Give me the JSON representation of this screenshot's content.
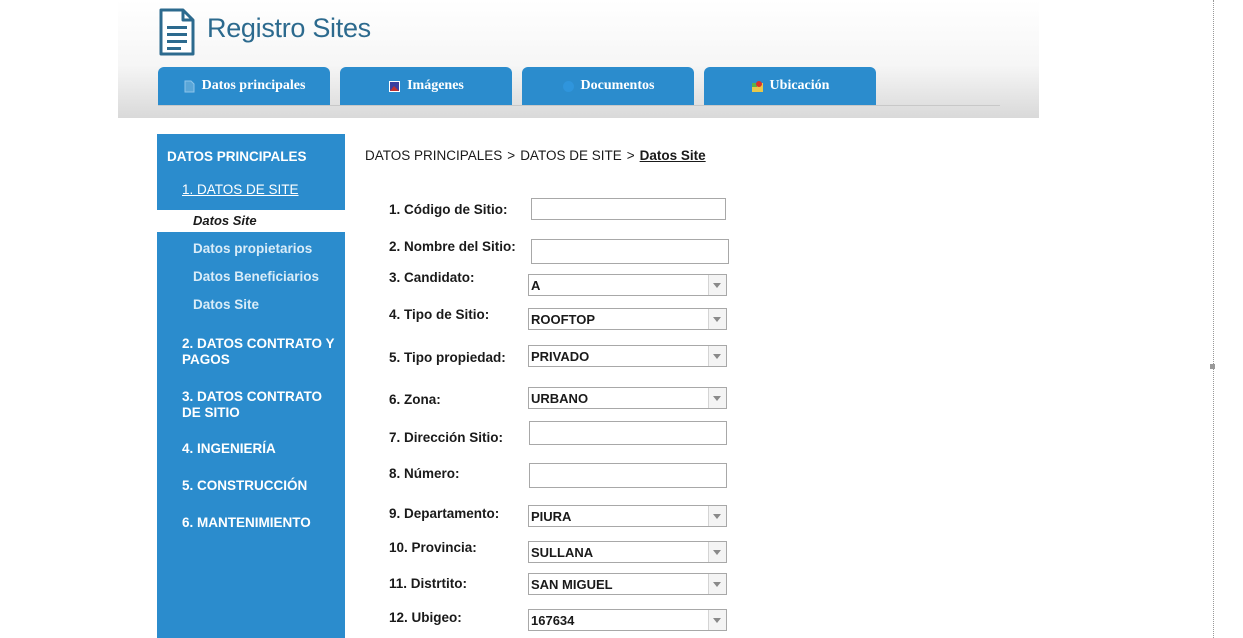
{
  "app": {
    "title": "Registro Sites"
  },
  "tabs": [
    {
      "label": "Datos principales",
      "icon": "document-icon"
    },
    {
      "label": "Imágenes",
      "icon": "image-icon"
    },
    {
      "label": "Documentos",
      "icon": "folder-icon"
    },
    {
      "label": "Ubicación",
      "icon": "map-icon"
    }
  ],
  "sidebar": {
    "heading": "DATOS PRINCIPALES",
    "section1": "1. DATOS DE SITE",
    "active_item": "Datos Site",
    "sub_items": [
      "Datos propietarios",
      "Datos Beneficiarios",
      "Datos Site"
    ],
    "sections": [
      "2. DATOS CONTRATO Y PAGOS",
      "3. DATOS CONTRATO DE SITIO",
      "4. INGENIERÍA",
      "5. CONSTRUCCIÓN",
      "6. MANTENIMIENTO"
    ]
  },
  "breadcrumb": {
    "items": [
      "DATOS PRINCIPALES",
      "DATOS DE SITE"
    ],
    "separator": ">",
    "current": "Datos Site"
  },
  "form": {
    "fields": [
      {
        "label": "1. Código de Sitio:",
        "type": "text",
        "value": ""
      },
      {
        "label": "2. Nombre del Sitio:",
        "type": "text",
        "value": ""
      },
      {
        "label": "3. Candidato:",
        "type": "select",
        "value": "A"
      },
      {
        "label": "4. Tipo de Sitio:",
        "type": "select",
        "value": "ROOFTOP"
      },
      {
        "label": "5. Tipo propiedad:",
        "type": "select",
        "value": "PRIVADO"
      },
      {
        "label": "6. Zona:",
        "type": "select",
        "value": "URBANO"
      },
      {
        "label": "7. Dirección Sitio:",
        "type": "text",
        "value": ""
      },
      {
        "label": "8. Número:",
        "type": "text",
        "value": ""
      },
      {
        "label": "9. Departamento:",
        "type": "select",
        "value": "PIURA"
      },
      {
        "label": "10. Provincia:",
        "type": "select",
        "value": "SULLANA"
      },
      {
        "label": "11. Distrtito:",
        "type": "select",
        "value": "SAN MIGUEL"
      },
      {
        "label": "12. Ubigeo:",
        "type": "select",
        "value": "167634"
      }
    ]
  },
  "colors": {
    "accent": "#2b8ccd",
    "title": "#2c6a8e"
  }
}
